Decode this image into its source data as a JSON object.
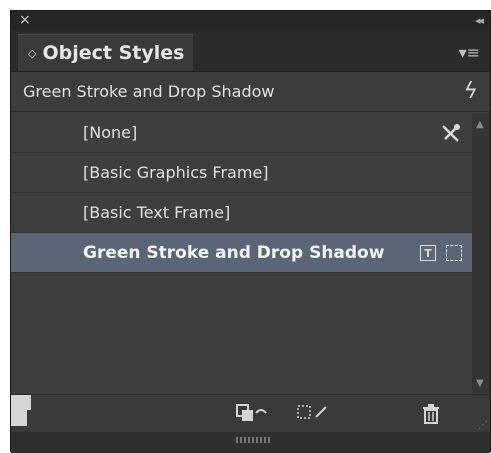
{
  "panel": {
    "close_glyph": "×",
    "collapse_glyph": "◂◂",
    "tab_chevron": "◇",
    "title": "Object Styles",
    "menu_glyph": "▾≡"
  },
  "current_style": {
    "label": "Green Stroke and Drop Shadow",
    "quick_apply_glyph": "ϟ"
  },
  "styles": [
    {
      "label": "[None]",
      "selected": false
    },
    {
      "label": "[Basic Graphics Frame]",
      "selected": false
    },
    {
      "label": "[Basic Text Frame]",
      "selected": false
    },
    {
      "label": "Green Stroke and Drop Shadow",
      "selected": true
    }
  ],
  "icons": {
    "none_row": "clear-style-icon",
    "selected_row": [
      "default-text-frame-icon",
      "default-graphic-frame-icon"
    ],
    "bottom": [
      "new-style-group-icon",
      "clear-overrides-icon",
      "clear-non-defined-attributes-icon",
      "create-new-style-icon",
      "delete-style-icon"
    ]
  },
  "colors": {
    "panel_bg": "#3c3c3c",
    "selected_row": "#5a6576",
    "text": "#e0e0e0"
  }
}
